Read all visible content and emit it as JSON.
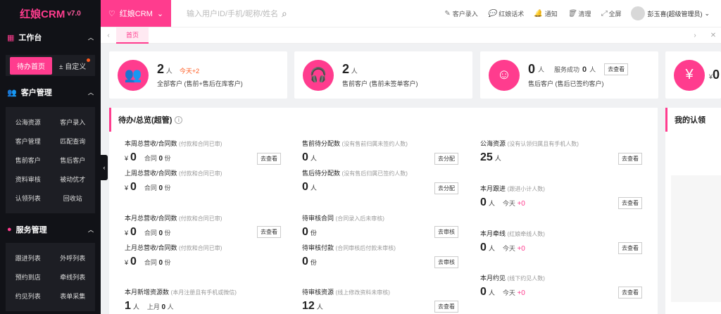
{
  "sidebar": {
    "logo": "红娘CRM",
    "version": "v7.0",
    "sections": [
      {
        "title": "工作台",
        "icon": "grid-icon"
      },
      {
        "title": "客户管理",
        "icon": "users-icon"
      },
      {
        "title": "服务管理",
        "icon": "service-icon"
      }
    ],
    "workbench": {
      "home": "待办首页",
      "custom": "自定义"
    },
    "customer_menu": [
      "公海资源",
      "客户录入",
      "客户管理",
      "匹配查询",
      "售前客户",
      "售后客户",
      "资料审核",
      "被动优才",
      "认领列表",
      "回收站"
    ],
    "service_menu": [
      "跟进列表",
      "外呼列表",
      "预约到店",
      "牵线列表",
      "约见列表",
      "表单采集"
    ]
  },
  "topbar": {
    "crm_select": "红娘CRM",
    "search_placeholder": "输入用户ID/手机/昵称/姓名",
    "actions": [
      "客户录入",
      "红娘话术",
      "通知",
      "清理",
      "全屏"
    ],
    "user": "彭玉喜(超级管理员)"
  },
  "tabbar": {
    "home_tab": "首页"
  },
  "stats": [
    {
      "value": "2",
      "unit": "人",
      "today": "今天+2",
      "label": "全部客户 (售前+售后在库客户)"
    },
    {
      "value": "2",
      "unit": "人",
      "label": "售前客户 (售前未签单客户)"
    },
    {
      "value": "0",
      "unit": "人",
      "extra_label": "服务成功",
      "extra_value": "0",
      "extra_unit": "人",
      "button": "去查看",
      "label": "售后客户 (售后已签约客户)"
    },
    {
      "value": "0",
      "unit": "¥"
    }
  ],
  "panel": {
    "title": "待办/总览(超管)",
    "col1": [
      {
        "title": "本周总营收/合同数",
        "note": "(付款和合同已审)",
        "yen": "¥",
        "value": "0",
        "sub_label": "合同",
        "sub_value": "0",
        "sub_unit": "份",
        "button": "去查看"
      },
      {
        "title": "上周总营收/合同数",
        "note": "(付款和合同已审)",
        "yen": "¥",
        "value": "0",
        "sub_label": "合同",
        "sub_value": "0",
        "sub_unit": "份"
      },
      {
        "title": "本月总营收/合同数",
        "note": "(付款和合同已审)",
        "yen": "¥",
        "value": "0",
        "sub_label": "合同",
        "sub_value": "0",
        "sub_unit": "份",
        "button": "去查看"
      },
      {
        "title": "上月总营收/合同数",
        "note": "(付款和合同已审)",
        "yen": "¥",
        "value": "0",
        "sub_label": "合同",
        "sub_value": "0",
        "sub_unit": "份"
      },
      {
        "title": "本月新增资源数",
        "note": "(本月注册且有手机或微信)",
        "value": "1",
        "unit": "人",
        "sub_label": "上月",
        "sub_value": "0",
        "sub_unit": "人"
      }
    ],
    "col2": [
      {
        "title": "售前待分配数",
        "note": "(没有售前归属未签约人数)",
        "value": "0",
        "unit": "人",
        "button": "去分配"
      },
      {
        "title": "售后待分配数",
        "note": "(没有售后归属已签约人数)",
        "value": "0",
        "unit": "人",
        "button": "去分配"
      },
      {
        "title": "待审核合同",
        "note": "(合同录入后未审核)",
        "value": "0",
        "unit": "份",
        "button": "去审核"
      },
      {
        "title": "待审核付款",
        "note": "(合同审核后付款未审核)",
        "value": "0",
        "unit": "份",
        "button": "去审核"
      },
      {
        "title": "待审核资源",
        "note": "(线上修改资料未审核)",
        "value": "12",
        "unit": "人",
        "button": "去查看"
      }
    ],
    "col3": [
      {
        "title": "公海资源",
        "note": "(没有认领归属且有手机人数)",
        "value": "25",
        "unit": "人",
        "button": "去查看"
      },
      {
        "title": "本月跟进",
        "note": "(跟进小计人数)",
        "value": "0",
        "unit": "人",
        "sub_label": "今天",
        "sub_value": "+0",
        "button": "去查看"
      },
      {
        "title": "本月牵线",
        "note": "(红娘牵线人数)",
        "value": "0",
        "unit": "人",
        "sub_label": "今天",
        "sub_value": "+0",
        "button": "去查看"
      },
      {
        "title": "本月约见",
        "note": "(线下约见人数)",
        "value": "0",
        "unit": "人",
        "sub_label": "今天",
        "sub_value": "+0",
        "button": "去查看"
      }
    ]
  },
  "panel2": {
    "title": "我的认领"
  },
  "colors": {
    "accent": "#ff3c8e",
    "sidebar_bg": "#111217",
    "today": "#ff5a1f"
  }
}
